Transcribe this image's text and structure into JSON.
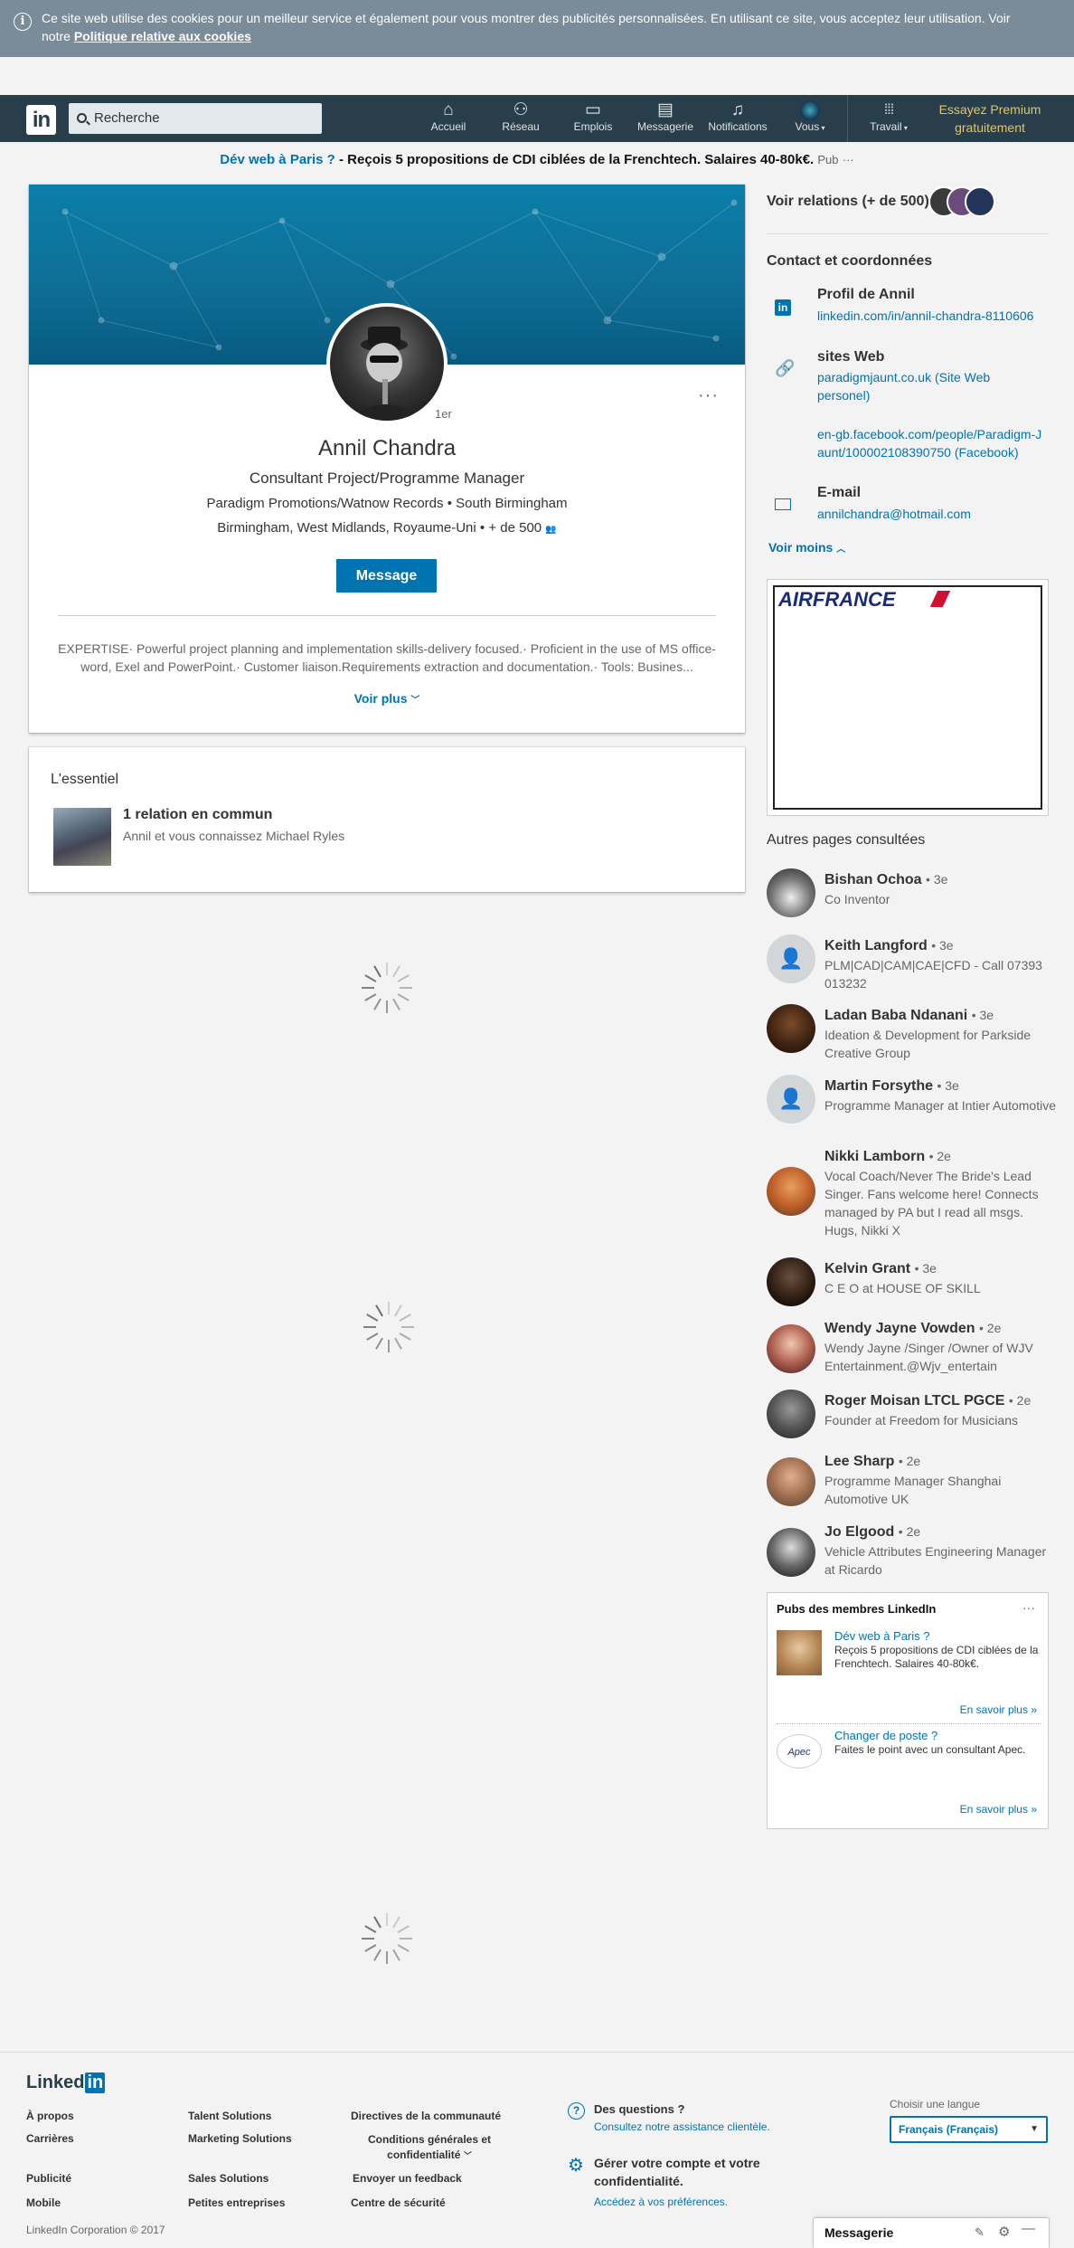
{
  "cookie_banner": {
    "text": "Ce site web utilise des cookies pour un meilleur service et également pour vous montrer des publicités personnalisées. En utilisant ce site, vous acceptez leur utilisation. Voir notre",
    "policy_link": "Politique relative aux cookies",
    "close": "✕"
  },
  "nav": {
    "logo": "in",
    "search_value": "Recherche",
    "items": [
      {
        "label": "Accueil",
        "icon": "home-icon"
      },
      {
        "label": "Réseau",
        "icon": "network-icon"
      },
      {
        "label": "Emplois",
        "icon": "jobs-icon"
      },
      {
        "label": "Messagerie",
        "icon": "messaging-icon"
      },
      {
        "label": "Notifications",
        "icon": "bell-icon"
      },
      {
        "label": "Vous",
        "icon": "avatar-icon"
      },
      {
        "label": "Travail",
        "icon": "grid-icon"
      }
    ],
    "premium": "Essayez Premium gratuitement"
  },
  "promo": {
    "link": "Dév web à Paris ?",
    "text": " - Reçois 5 propositions de CDI ciblées de la Frenchtech. Salaires 40-80k€.",
    "pub": "Pub",
    "more": "···"
  },
  "profile": {
    "degree": "1er",
    "more": "···",
    "name": "Annil Chandra",
    "headline": "Consultant Project/Programme Manager",
    "company": "Paradigm Promotions/Watnow Records",
    "school": "South Birmingham",
    "location": "Birmingham, West Midlands, Royaume-Uni",
    "connections": "+ de 500",
    "message_button": "Message",
    "summary": "EXPERTISE· Powerful project planning and implementation skills-delivery focused.· Proficient in the use of MS office-word, Exel and PowerPoint.· Customer liaison.Requirements extraction and documentation.· Tools: Busines...",
    "see_more": "Voir plus"
  },
  "highlights": {
    "title": "L'essentiel",
    "shared_title": "1 relation en commun",
    "shared_sub": "Annil et vous connaissez Michael Ryles"
  },
  "sidebar": {
    "connections": "Voir relations (+ de 500)",
    "contact_title": "Contact et coordonnées",
    "profile_label": "Profil de Annil",
    "profile_url": "linkedin.com/in/annil-chandra-8110606",
    "websites_label": "sites Web",
    "website1": "paradigmjaunt.co.uk  (Site Web personel)",
    "website2": "en-gb.facebook.com/people/Paradigm-Jaunt/100002108390750  (Facebook)",
    "email_label": "E-mail",
    "email": "annilchandra@hotmail.com",
    "see_less": "Voir moins",
    "ad_brand": "AIRFRANCE",
    "pages_title": "Autres pages consultées",
    "people": [
      {
        "name": "Bishan Ochoa",
        "degree": "• 3e",
        "desc": "Co Inventor"
      },
      {
        "name": "Keith Langford",
        "degree": "• 3e",
        "desc": "PLM|CAD|CAM|CAE|CFD - Call 07393 013232"
      },
      {
        "name": "Ladan Baba Ndanani",
        "degree": "• 3e",
        "desc": "Ideation & Development for Parkside Creative Group"
      },
      {
        "name": "Martin Forsythe",
        "degree": "• 3e",
        "desc": "Programme Manager at Intier Automotive"
      },
      {
        "name": "Nikki Lamborn",
        "degree": "• 2e",
        "desc": "Vocal Coach/Never The Bride's Lead Singer. Fans welcome here! Connects managed by PA but I read all msgs. Hugs, Nikki X"
      },
      {
        "name": "Kelvin Grant",
        "degree": "• 3e",
        "desc": "C E O at HOUSE OF SKILL"
      },
      {
        "name": "Wendy Jayne Vowden",
        "degree": "• 2e",
        "desc": "Wendy Jayne /Singer /Owner of WJV Entertainment.@Wjv_entertain"
      },
      {
        "name": "Roger Moisan LTCL PGCE",
        "degree": "• 2e",
        "desc": "Founder at Freedom for Musicians"
      },
      {
        "name": "Lee Sharp",
        "degree": "• 2e",
        "desc": "Programme Manager Shanghai Automotive UK"
      },
      {
        "name": "Jo Elgood",
        "degree": "• 2e",
        "desc": "Vehicle Attributes Engineering Manager at Ricardo"
      }
    ],
    "ads": {
      "title": "Pubs des membres LinkedIn",
      "more": "···",
      "ad1_title": "Dév web à Paris ?",
      "ad1_text": "Reçois 5 propositions de CDI ciblées de la Frenchtech. Salaires 40-80k€.",
      "ad1_link": "En savoir plus »",
      "ad2_title": "Changer de poste ?",
      "ad2_text": "Faites le point avec un consultant Apec.",
      "ad2_link": "En savoir plus »"
    }
  },
  "footer": {
    "brand": "Linked",
    "brand_in": "in",
    "links_col1": [
      "À propos",
      "Carrières",
      "Publicité",
      "Mobile"
    ],
    "links_col2": [
      "Talent Solutions",
      "Marketing Solutions",
      "Sales Solutions",
      "Petites entreprises"
    ],
    "links_col3": [
      "Directives de la communauté",
      "Conditions générales et confidentialité",
      "Envoyer un feedback",
      "Centre de sécurité"
    ],
    "questions_title": "Des questions ?",
    "questions_sub": "Consultez notre assistance clientèle.",
    "manage_title": "Gérer votre compte et votre confidentialité.",
    "manage_sub": "Accédez à vos préférences.",
    "lang_label": "Choisir une langue",
    "lang_value": "Français (Français)",
    "copyright": "LinkedIn Corporation © 2017"
  },
  "messaging": {
    "label": "Messagerie"
  }
}
